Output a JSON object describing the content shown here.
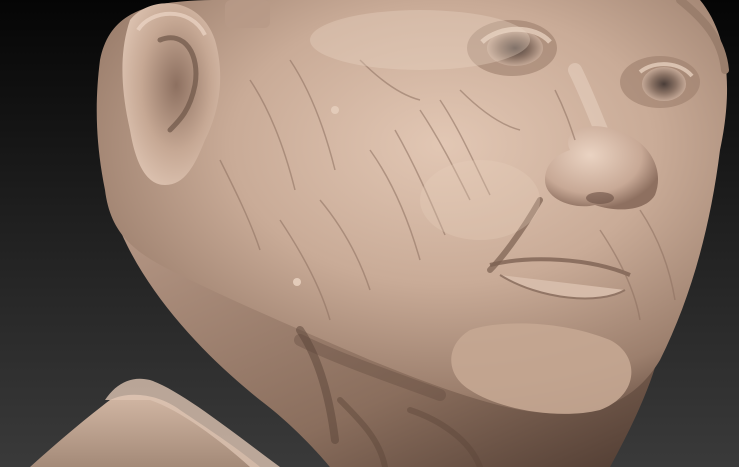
{
  "viewport": {
    "background_top": "#050505",
    "background_bottom": "#3a3a3a",
    "clay_color": "#c9ab97",
    "clay_shadow": "#6e5547",
    "clay_highlight": "#e4ccbb"
  }
}
